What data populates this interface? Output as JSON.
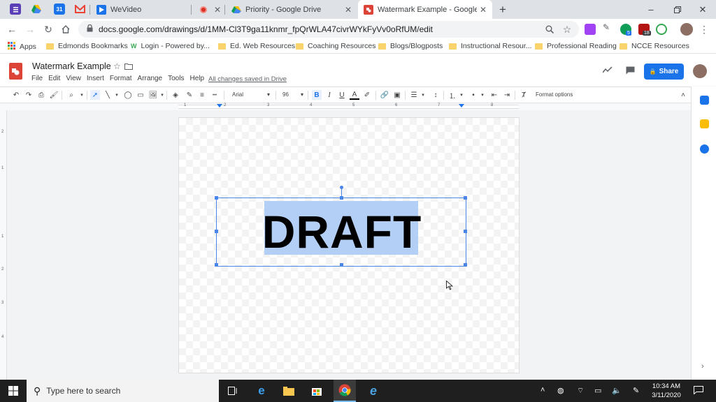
{
  "tabs": [
    {
      "title": "WeVideo",
      "icon": "wevideo-icon"
    },
    {
      "title": "Priority - Google Drive",
      "icon": "google-drive-icon"
    },
    {
      "title": "Watermark Example - Google Dr",
      "icon": "google-drawings-icon",
      "active": true
    }
  ],
  "address_bar": {
    "url": "docs.google.com/drawings/d/1MM-Cl3T9ga11knmr_fpQrWLA47civrWYkFyVv0oRfUM/edit"
  },
  "extensions": {
    "badge_1": "5",
    "badge_2": "18"
  },
  "bookmarks": [
    {
      "label": "Apps",
      "icon": "apps-grid-icon"
    },
    {
      "label": "Edmonds Bookmarks",
      "icon": "folder-icon"
    },
    {
      "label": "Login - Powered by...",
      "icon": "link-icon"
    },
    {
      "label": "Ed. Web Resources",
      "icon": "folder-icon"
    },
    {
      "label": "Coaching Resources",
      "icon": "folder-icon"
    },
    {
      "label": "Blogs/Blogposts",
      "icon": "folder-icon"
    },
    {
      "label": "Instructional Resour...",
      "icon": "folder-icon"
    },
    {
      "label": "Professional Reading",
      "icon": "folder-icon"
    },
    {
      "label": "NCCE Resources",
      "icon": "folder-icon"
    }
  ],
  "app": {
    "doc_title": "Watermark Example",
    "menus": [
      "File",
      "Edit",
      "View",
      "Insert",
      "Format",
      "Arrange",
      "Tools",
      "Help"
    ],
    "save_status": "All changes saved in Drive",
    "share_label": "Share"
  },
  "toolbar": {
    "font": "Arial",
    "font_size": "96",
    "format_options": "Format options"
  },
  "ruler": {
    "h_numbers": [
      "1",
      "2",
      "3",
      "4",
      "5",
      "6",
      "7",
      "8"
    ],
    "v_numbers": [
      "2",
      "1",
      "1",
      "2",
      "3",
      "4"
    ]
  },
  "canvas": {
    "text": "DRAFT"
  },
  "taskbar": {
    "search_placeholder": "Type here to search",
    "time": "10:34 AM",
    "date": "3/11/2020"
  },
  "colors": {
    "accent": "#1a73e8",
    "selection": "#4a86e8"
  }
}
